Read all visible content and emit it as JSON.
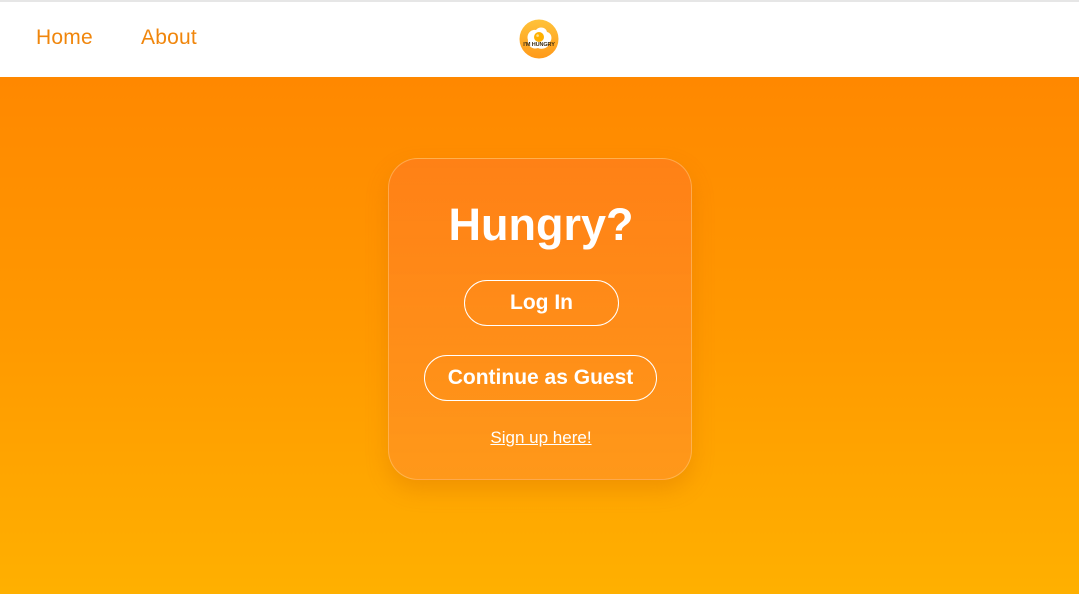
{
  "nav": {
    "home_label": "Home",
    "about_label": "About",
    "logo_text": "I'M HUNGRY"
  },
  "card": {
    "title": "Hungry?",
    "login_label": "Log In",
    "guest_label": "Continue as Guest",
    "signup_label": "Sign up here!"
  },
  "colors": {
    "accent": "#f0860c",
    "hero_top": "#ff8800",
    "hero_bottom": "#ffb000",
    "text_on_accent": "#ffffff"
  }
}
